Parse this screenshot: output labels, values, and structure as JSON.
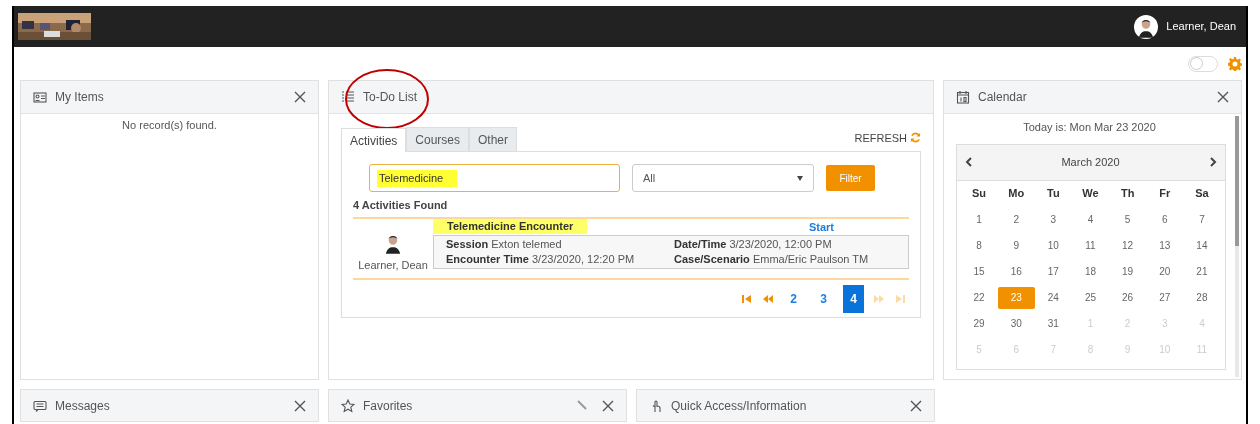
{
  "header": {
    "user_name": "Learner, Dean"
  },
  "toolbar": {
    "toggle_on": false
  },
  "my_items": {
    "title": "My Items",
    "empty_text": "No record(s) found."
  },
  "todo": {
    "title": "To-Do List",
    "refresh": "REFRESH",
    "tabs": [
      {
        "label": "Activities",
        "selected": true
      },
      {
        "label": "Courses",
        "selected": false
      },
      {
        "label": "Other",
        "selected": false
      }
    ],
    "search": {
      "value": "Telemedicine"
    },
    "type_select": {
      "value": "All"
    },
    "filter_button": "Filter",
    "found_text": "4 Activities Found",
    "activity": {
      "title": "Telemedicine Encounter",
      "start": "Start",
      "learner": "Learner, Dean",
      "fields": [
        {
          "label": "Session",
          "value": "Exton telemed"
        },
        {
          "label": "Date/Time",
          "value": "3/23/2020, 12:00 PM"
        },
        {
          "label": "Encounter Time",
          "value": "3/23/2020, 12:20 PM"
        },
        {
          "label": "Case/Scenario",
          "value": "Emma/Eric Paulson TM"
        }
      ]
    },
    "pagination": [
      {
        "kind": "first",
        "disabled": false
      },
      {
        "kind": "prev",
        "disabled": false
      },
      {
        "kind": "page",
        "label": "2",
        "selected": false
      },
      {
        "kind": "page",
        "label": "3",
        "selected": false
      },
      {
        "kind": "page",
        "label": "4",
        "selected": true
      },
      {
        "kind": "next",
        "disabled": true
      },
      {
        "kind": "last",
        "disabled": true
      }
    ]
  },
  "calendar": {
    "title": "Calendar",
    "today_text": "Today is: Mon Mar 23 2020",
    "month": "March 2020",
    "weekdays": [
      "Su",
      "Mo",
      "Tu",
      "We",
      "Th",
      "Fr",
      "Sa"
    ],
    "weeks": [
      [
        {
          "label": "1",
          "muted": false,
          "selected": false
        },
        {
          "label": "2",
          "muted": false,
          "selected": false
        },
        {
          "label": "3",
          "muted": false,
          "selected": false
        },
        {
          "label": "4",
          "muted": false,
          "selected": false
        },
        {
          "label": "5",
          "muted": false,
          "selected": false
        },
        {
          "label": "6",
          "muted": false,
          "selected": false
        },
        {
          "label": "7",
          "muted": false,
          "selected": false
        }
      ],
      [
        {
          "label": "8",
          "muted": false,
          "selected": false
        },
        {
          "label": "9",
          "muted": false,
          "selected": false
        },
        {
          "label": "10",
          "muted": false,
          "selected": false
        },
        {
          "label": "11",
          "muted": false,
          "selected": false
        },
        {
          "label": "12",
          "muted": false,
          "selected": false
        },
        {
          "label": "13",
          "muted": false,
          "selected": false
        },
        {
          "label": "14",
          "muted": false,
          "selected": false
        }
      ],
      [
        {
          "label": "15",
          "muted": false,
          "selected": false
        },
        {
          "label": "16",
          "muted": false,
          "selected": false
        },
        {
          "label": "17",
          "muted": false,
          "selected": false
        },
        {
          "label": "18",
          "muted": false,
          "selected": false
        },
        {
          "label": "19",
          "muted": false,
          "selected": false
        },
        {
          "label": "20",
          "muted": false,
          "selected": false
        },
        {
          "label": "21",
          "muted": false,
          "selected": false
        }
      ],
      [
        {
          "label": "22",
          "muted": false,
          "selected": false
        },
        {
          "label": "23",
          "muted": false,
          "selected": true
        },
        {
          "label": "24",
          "muted": false,
          "selected": false
        },
        {
          "label": "25",
          "muted": false,
          "selected": false
        },
        {
          "label": "26",
          "muted": false,
          "selected": false
        },
        {
          "label": "27",
          "muted": false,
          "selected": false
        },
        {
          "label": "28",
          "muted": false,
          "selected": false
        }
      ],
      [
        {
          "label": "29",
          "muted": false,
          "selected": false
        },
        {
          "label": "30",
          "muted": false,
          "selected": false
        },
        {
          "label": "31",
          "muted": false,
          "selected": false
        },
        {
          "label": "1",
          "muted": true,
          "selected": false
        },
        {
          "label": "2",
          "muted": true,
          "selected": false
        },
        {
          "label": "3",
          "muted": true,
          "selected": false
        },
        {
          "label": "4",
          "muted": true,
          "selected": false
        }
      ],
      [
        {
          "label": "5",
          "muted": true,
          "selected": false
        },
        {
          "label": "6",
          "muted": true,
          "selected": false
        },
        {
          "label": "7",
          "muted": true,
          "selected": false
        },
        {
          "label": "8",
          "muted": true,
          "selected": false
        },
        {
          "label": "9",
          "muted": true,
          "selected": false
        },
        {
          "label": "10",
          "muted": true,
          "selected": false
        },
        {
          "label": "11",
          "muted": true,
          "selected": false
        }
      ]
    ]
  },
  "bottom_panels": [
    {
      "kind": "messages",
      "title": "Messages",
      "editable": false
    },
    {
      "kind": "favorites",
      "title": "Favorites",
      "editable": true
    },
    {
      "kind": "quick",
      "title": "Quick Access/Information",
      "editable": false
    }
  ]
}
